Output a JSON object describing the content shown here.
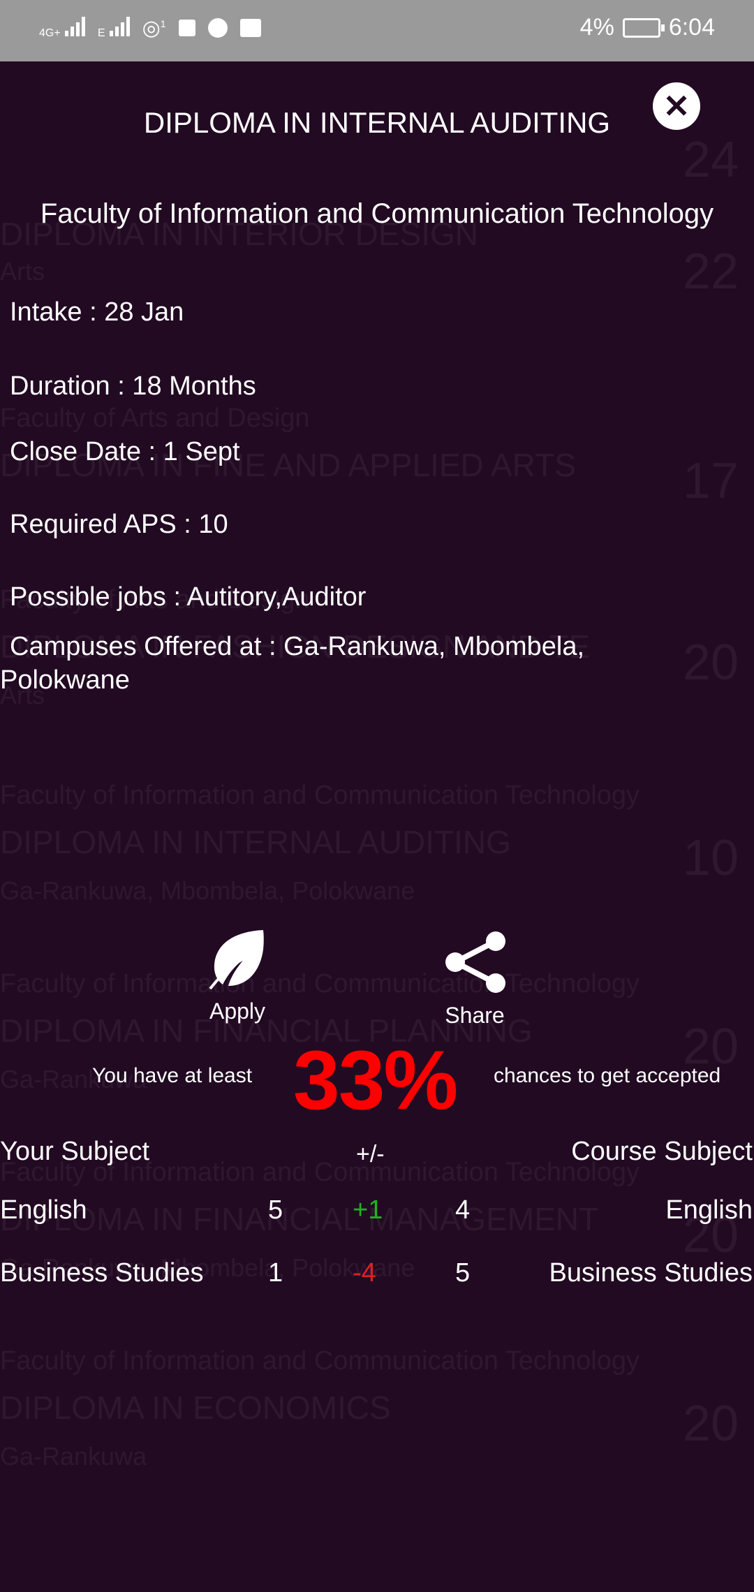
{
  "status_bar": {
    "net1": "4G+",
    "net2": "E",
    "hotspot_badge": "1",
    "battery_pct": "4%",
    "time": "6:04"
  },
  "background_list": [
    {
      "faculty": "",
      "title": "",
      "campus": "",
      "num": "24"
    },
    {
      "faculty": "",
      "title": "DIPLOMA IN INTERIOR DESIGN",
      "campus": "Arts",
      "num": "22"
    },
    {
      "faculty": "Faculty of Arts and Design",
      "title": "DIPLOMA IN FINE AND APPLIED ARTS",
      "campus": "",
      "num": "17"
    },
    {
      "faculty": "Faculty of Arts and Design",
      "title": "DIPLOMA IN FASHION DESIGN AND TE",
      "campus": "Arts",
      "num": "20"
    },
    {
      "faculty": "Faculty of Information and Communication Technology",
      "title": "DIPLOMA IN INTERNAL AUDITING",
      "campus": "Ga-Rankuwa, Mbombela, Polokwane",
      "num": "10"
    },
    {
      "faculty": "Faculty of Information and Communication Technology",
      "title": "DIPLOMA IN FINANCIAL PLANNING",
      "campus": "Ga-Rankuwa",
      "num": "20"
    },
    {
      "faculty": "Faculty of Information and Communication Technology",
      "title": "DIPLOMA IN FINANCIAL MANAGEMENT",
      "campus": "Ga-Rankuwa, Mbombela, Polokwane",
      "num": "20"
    },
    {
      "faculty": "Faculty of Information and Communication Technology",
      "title": "DIPLOMA IN ECONOMICS",
      "campus": "Ga-Rankuwa",
      "num": "20"
    }
  ],
  "dialog": {
    "title": "DIPLOMA IN INTERNAL AUDITING",
    "faculty": "Faculty of Information and Communication Technology",
    "intake": "Intake : 28 Jan",
    "duration": "Duration : 18 Months",
    "close_date": "Close Date : 1 Sept",
    "required_aps": "Required APS : 10",
    "possible_jobs": "Possible jobs : Autitory,Auditor",
    "campuses_line1": "Campuses Offered at : Ga-Rankuwa, Mbombela,",
    "campuses_line2": "Polokwane",
    "apply_label": "Apply",
    "share_label": "Share",
    "chance_prefix": "You have at least",
    "chance_pct": "33%",
    "chance_suffix": "chances to get accepted"
  },
  "subjects": {
    "headers": {
      "your": "Your Subject",
      "diff": "+/-",
      "course": "Course Subject"
    },
    "rows": [
      {
        "your_subject": "English",
        "your_level": "5",
        "diff": "+1",
        "course_level": "4",
        "course_subject": "English"
      },
      {
        "your_subject": "Business Studies",
        "your_level": "1",
        "diff": "-4",
        "course_level": "5",
        "course_subject": "Business Studies"
      }
    ]
  },
  "colors": {
    "background": "#220a22",
    "status_bar": "#9a9a9a",
    "chance": "#ff0000",
    "positive": "#1fb31f",
    "negative": "#e02020"
  }
}
